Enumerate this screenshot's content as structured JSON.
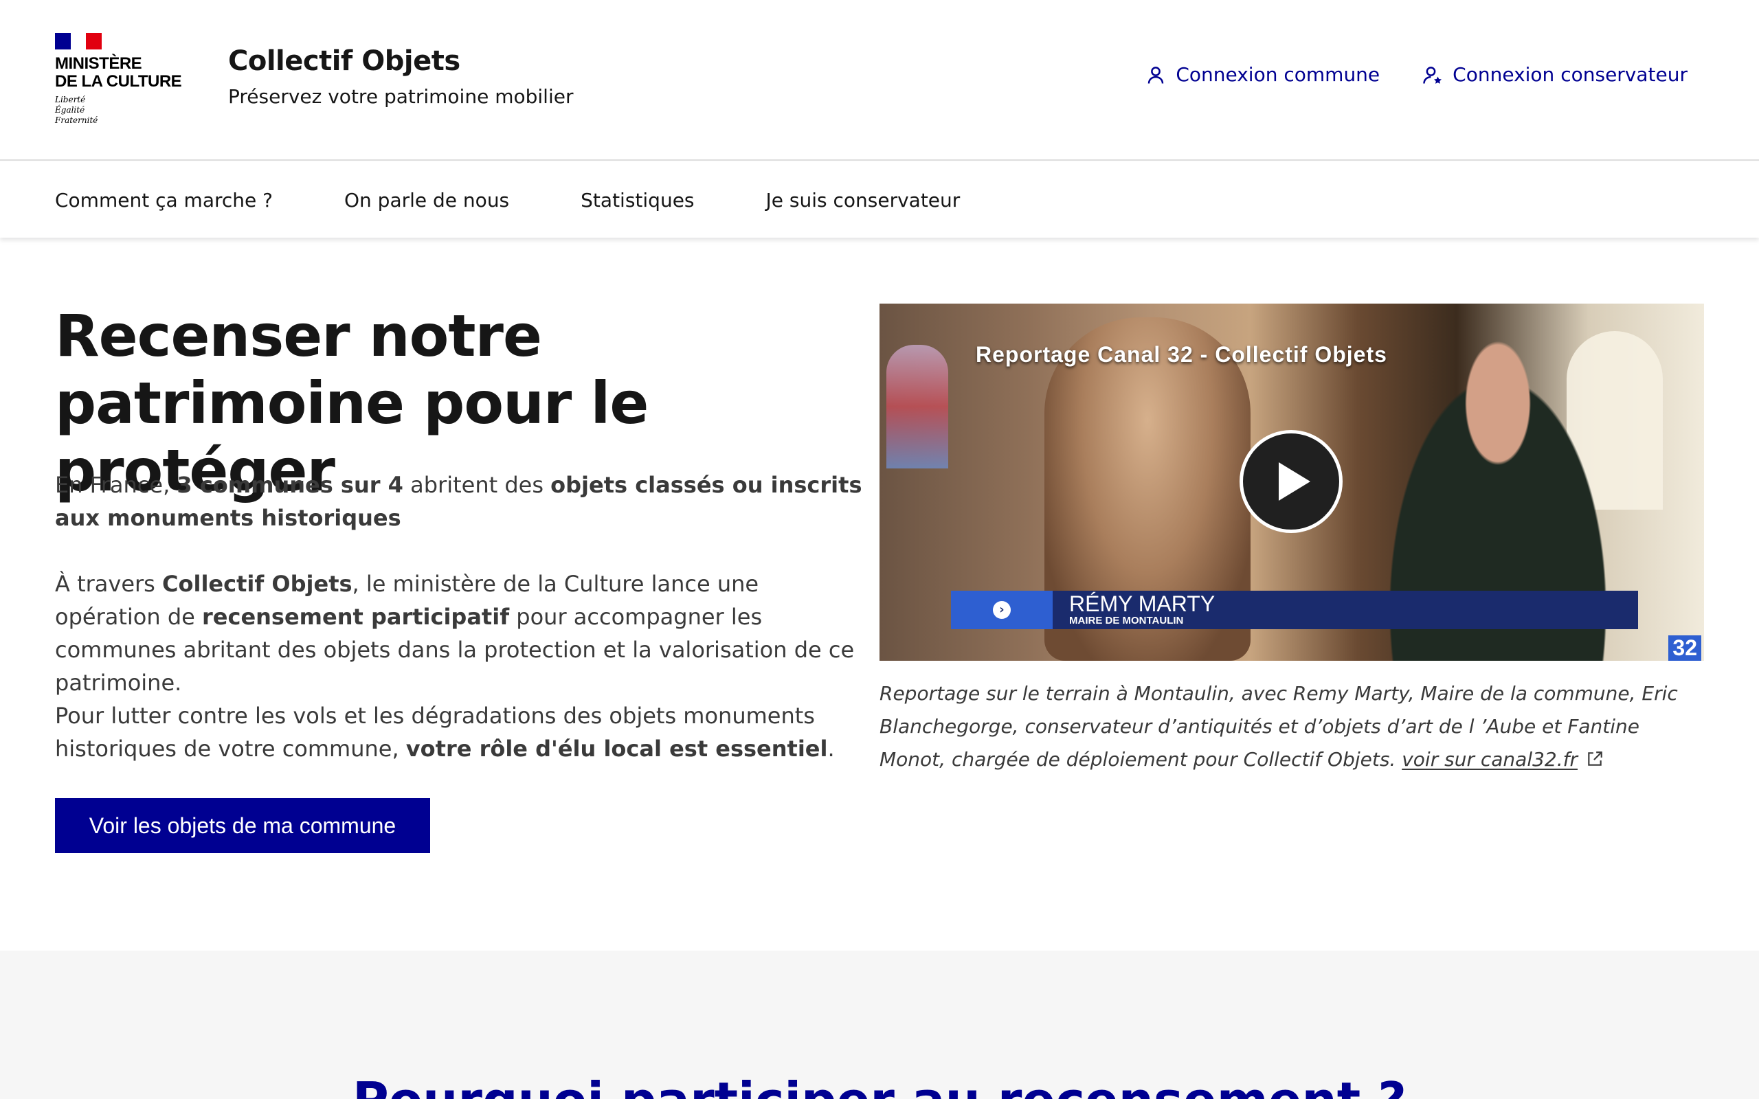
{
  "header": {
    "logo": {
      "ministry": "MINISTÈRE\nDE LA CULTURE",
      "motto": "Liberté\nÉgalité\nFraternité",
      "flag_colors": [
        "#000091",
        "#ffffff",
        "#e1000f"
      ]
    },
    "service_title": "Collectif Objets",
    "service_tagline": "Préservez votre patrimoine mobilier",
    "tools": [
      {
        "label": "Connexion commune",
        "icon": "user-icon"
      },
      {
        "label": "Connexion conservateur",
        "icon": "user-star-icon"
      }
    ]
  },
  "nav": {
    "items": [
      "Comment ça marche ?",
      "On parle de nous",
      "Statistiques",
      "Je suis conservateur"
    ]
  },
  "hero": {
    "title": "Recenser notre patrimoine pour le protéger",
    "p1": {
      "t1": "En France, ",
      "b1": "3 communes sur 4",
      "t2": " abritent des ",
      "b2": "objets classés ou inscrits aux monuments historiques"
    },
    "p2": {
      "t1": "À travers ",
      "b1": "Collectif Objets",
      "t2": ", le ministère de la Culture lance une opération de ",
      "b2": "recensement participatif",
      "t3": " pour accompagner les communes abritant des objets dans la protection et la valorisation de ce patrimoine."
    },
    "p3": {
      "t1": "Pour lutter contre les vols et les dégradations des objets monuments historiques de votre commune, ",
      "b1": "votre rôle d'élu local est essentiel",
      "t2": "."
    },
    "cta_label": "Voir les objets de ma commune"
  },
  "video": {
    "title": "Reportage Canal 32 - Collectif Objets",
    "lower_third_name": "RÉMY MARTY",
    "lower_third_role": "MAIRE DE MONTAULIN",
    "channel_badge": "32",
    "caption": "Reportage sur le terrain à Montaulin, avec Remy Marty, Maire de la commune, Eric Blanchegorge, conservateur d’antiquités et d’objets d’art de l ’Aube et Fantine Monot, chargée de déploiement pour Collectif Objets. ",
    "caption_link": "voir sur canal32.fr",
    "colors": {
      "lower_third_bg": "#1a2b6d",
      "lower_third_accent": "#2e5fd1"
    }
  },
  "bottom": {
    "title": "Pourquoi participer au recensement ?"
  },
  "colors": {
    "primary": "#000091",
    "text": "#161616",
    "body_text": "#3a3a3a",
    "section_bg": "#f6f6f6"
  }
}
